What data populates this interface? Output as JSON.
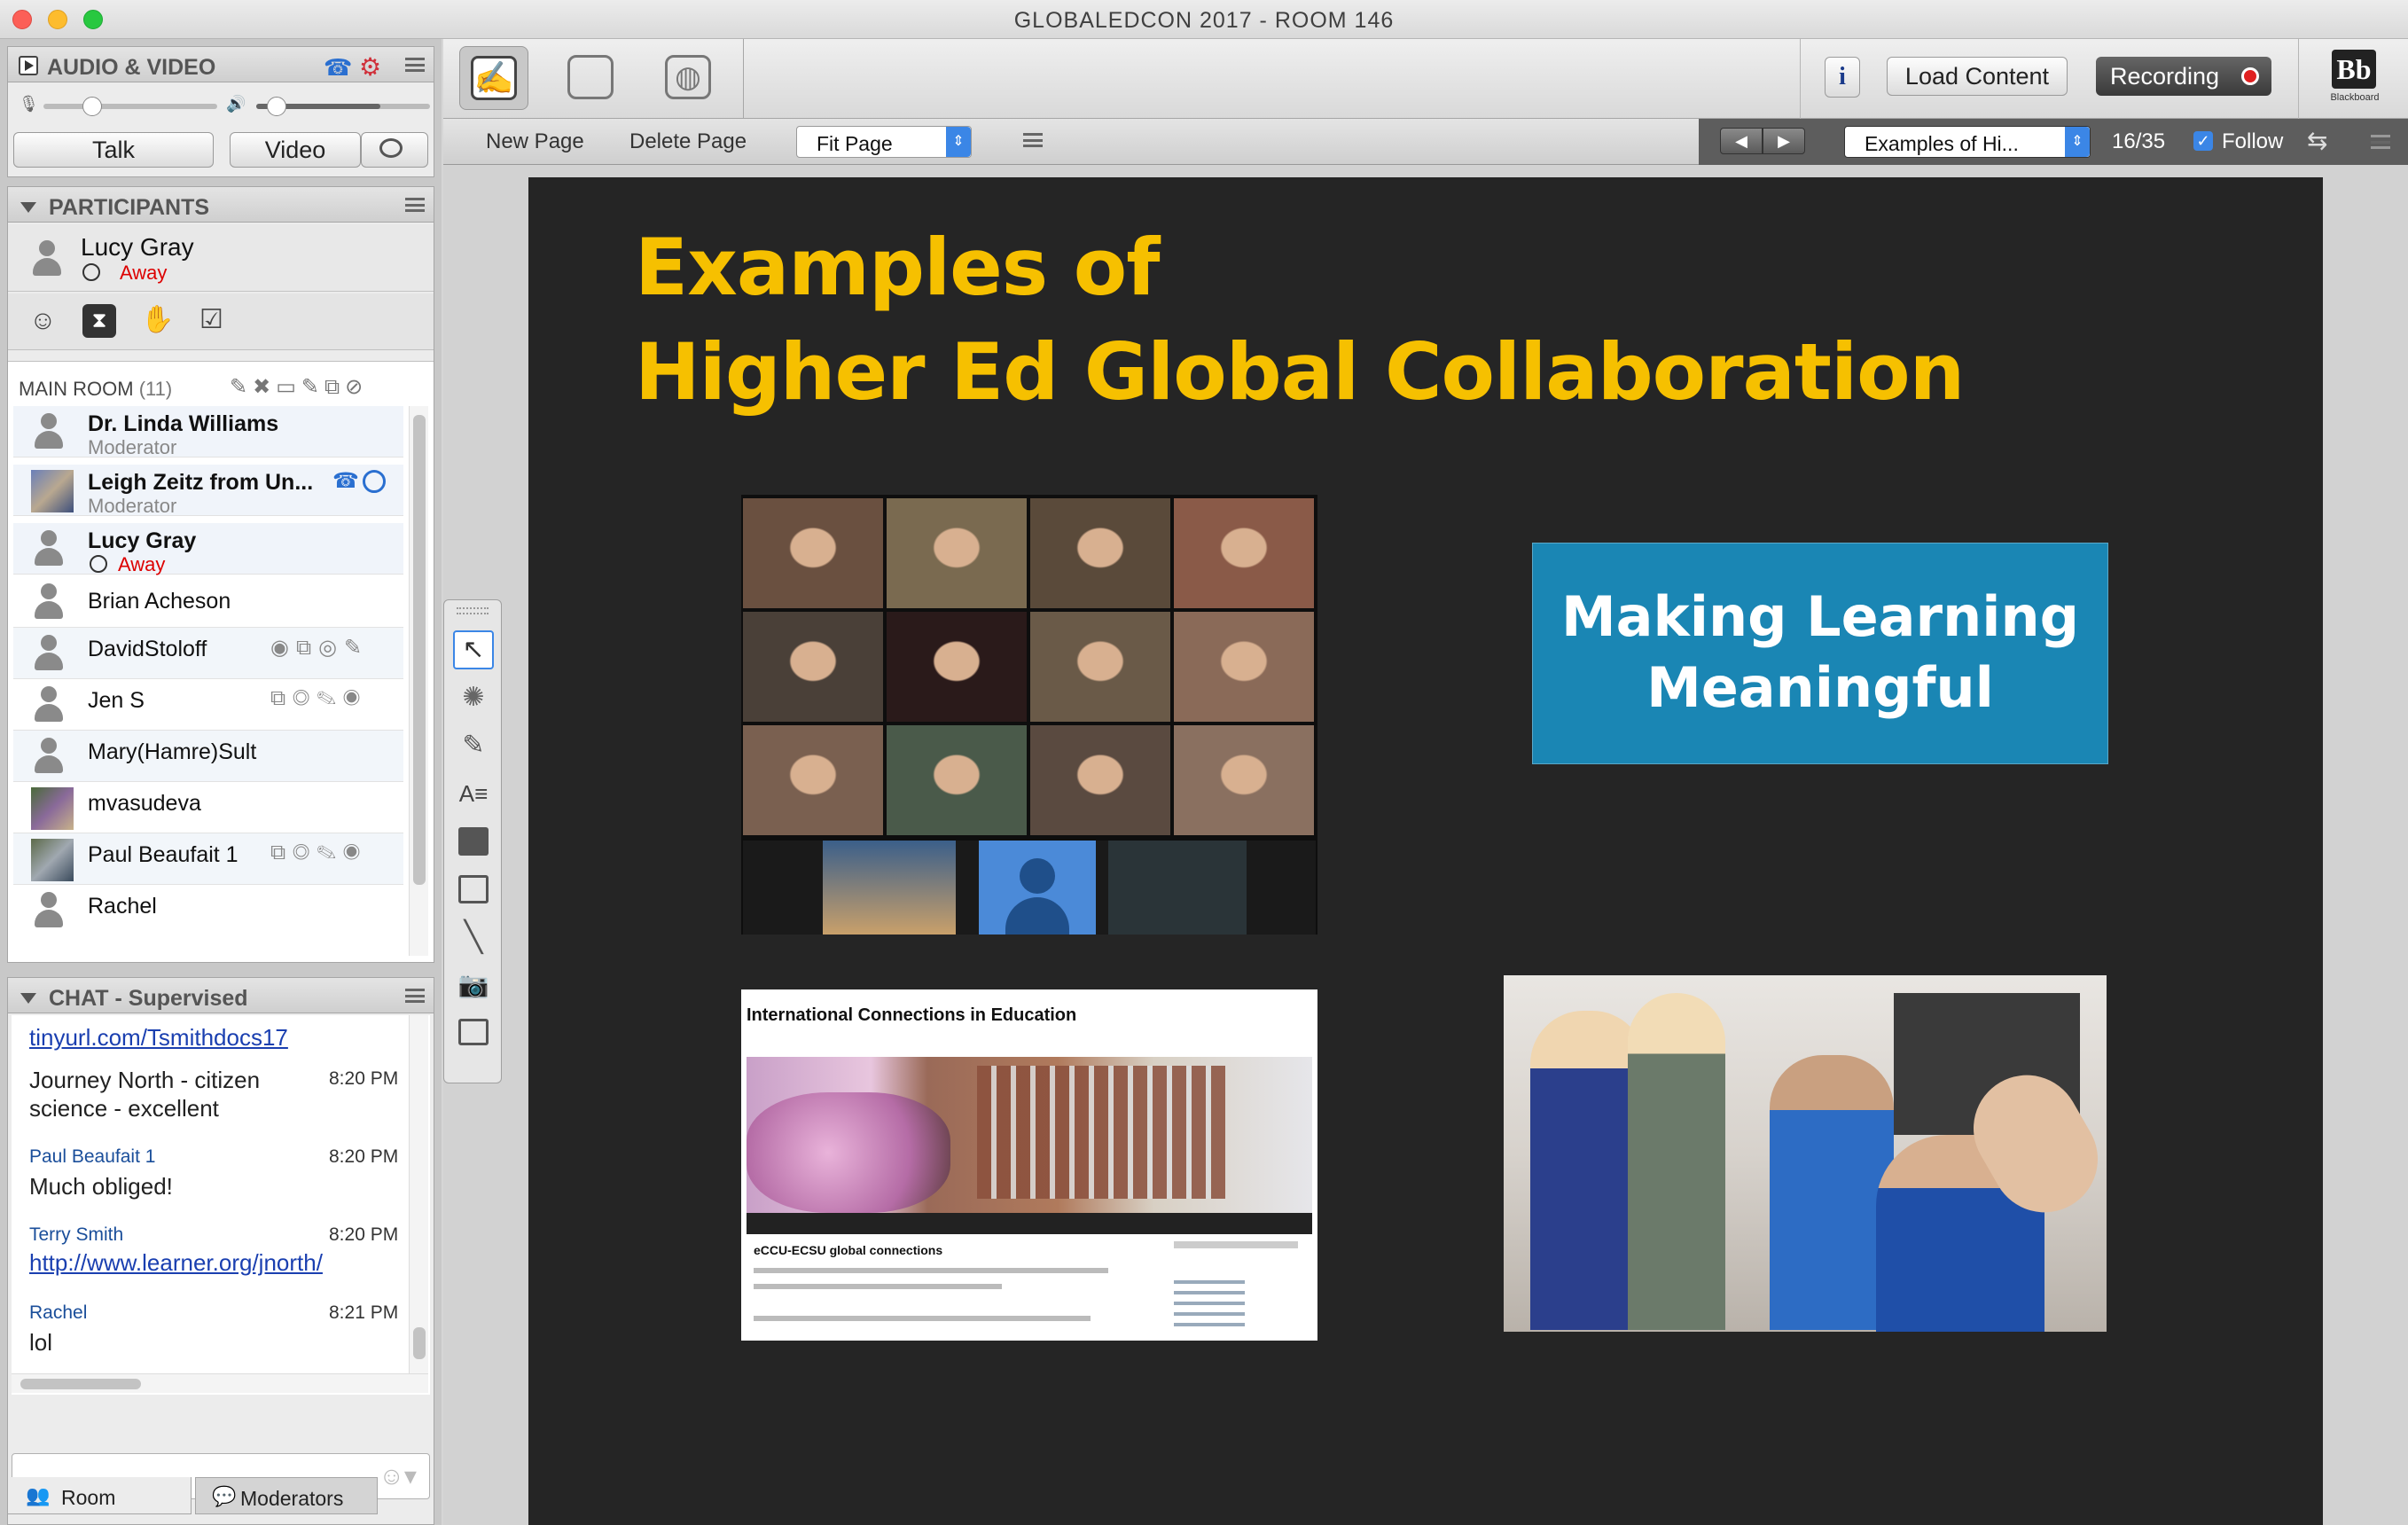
{
  "window": {
    "title": "GLOBALEDCON 2017 - ROOM 146"
  },
  "audio_video": {
    "header": "AUDIO & VIDEO",
    "talk_label": "Talk",
    "video_label": "Video"
  },
  "participants": {
    "header": "PARTICIPANTS",
    "me": {
      "name": "Lucy Gray",
      "status": "Away"
    },
    "room_label": "MAIN ROOM",
    "room_count": "(11)",
    "list": [
      {
        "name": "Dr. Linda Williams",
        "role": "Moderator"
      },
      {
        "name": "Leigh Zeitz from Un...",
        "role": "Moderator"
      },
      {
        "name": "Lucy Gray",
        "status": "Away"
      },
      {
        "name": "Brian Acheson"
      },
      {
        "name": "DavidStoloff"
      },
      {
        "name": "Jen S"
      },
      {
        "name": "Mary(Hamre)Sult"
      },
      {
        "name": "mvasudeva"
      },
      {
        "name": "Paul Beaufait 1"
      },
      {
        "name": "Rachel"
      }
    ]
  },
  "chat": {
    "header": "CHAT - Supervised",
    "messages": [
      {
        "text": "tinyurl.com/Tsmithdocs17"
      },
      {
        "text_line1": "Journey North - citizen",
        "text_line2": "science - excellent",
        "time": "8:20 PM"
      },
      {
        "sender": "Paul Beaufait 1",
        "time": "8:20 PM",
        "text": "Much obliged!"
      },
      {
        "sender": "Terry Smith",
        "time": "8:20 PM",
        "text": "http://www.learner.org/jnorth/"
      },
      {
        "sender": "Rachel",
        "time": "8:21 PM",
        "text": "lol"
      }
    ],
    "tabs": {
      "room": "Room",
      "moderators": "Moderators"
    }
  },
  "toolbar": {
    "load_content": "Load Content",
    "recording": "Recording",
    "new_page": "New Page",
    "delete_page": "Delete Page",
    "zoom": "Fit Page",
    "page_select": "Examples of Hi...",
    "page_counter": "16/35",
    "follow": "Follow",
    "brand": "Bb",
    "brand_sub": "Blackboard"
  },
  "slide": {
    "title_line1": "Examples of",
    "title_line2": "Higher Ed Global Collaboration",
    "box_text_line1": "Making Learning",
    "box_text_line2": "Meaningful",
    "website_title": "International Connections in Education",
    "website_post": "eCCU-ECSU global connections"
  },
  "colors": {
    "slide_title": "#f6c000",
    "slide_bg": "#252525",
    "teal_box": "#1a86b4",
    "away": "#dd0000",
    "link": "#1a3fb0"
  }
}
